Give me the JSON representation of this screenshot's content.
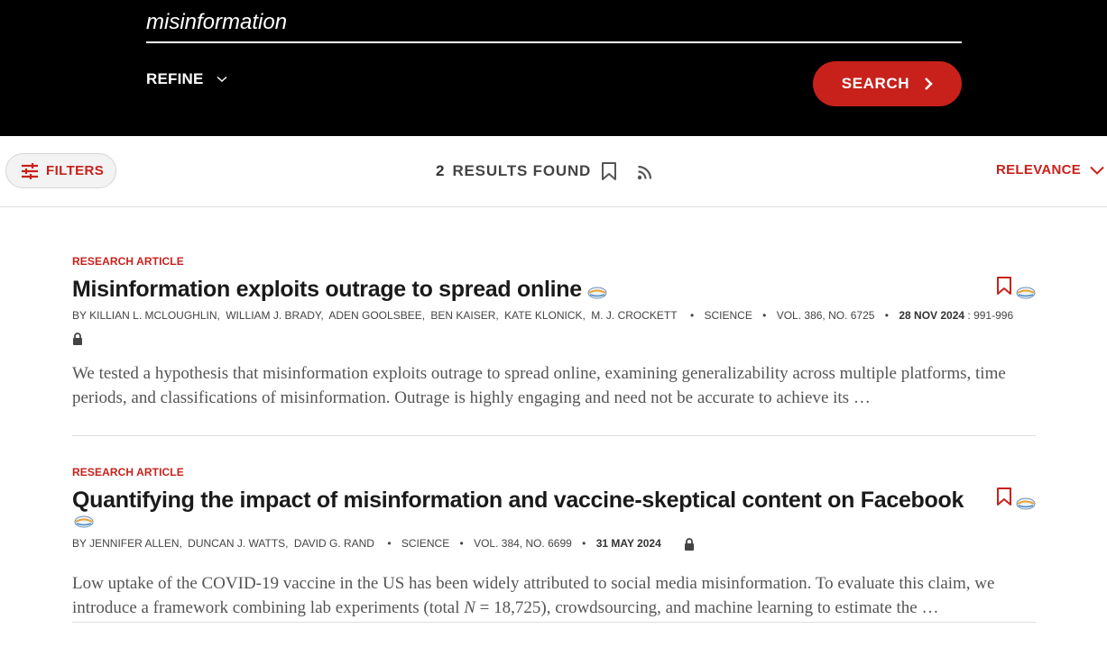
{
  "header": {
    "search_value": "misinformation",
    "refine_label": "REFINE",
    "search_button_label": "SEARCH"
  },
  "toolbar": {
    "filters_label": "FILTERS",
    "results_count": "2",
    "results_label": "RESULTS FOUND",
    "sort_label": "RELEVANCE"
  },
  "colors": {
    "accent": "#c8211b",
    "header_bg": "#000000"
  },
  "results": [
    {
      "type": "RESEARCH ARTICLE",
      "title": "Misinformation exploits outrage to spread online",
      "authors": [
        "BY KILLIAN L. MCLOUGHLIN,",
        "WILLIAM J. BRADY,",
        "ADEN GOOLSBEE,",
        "BEN KAISER,",
        "KATE KLONICK,",
        "M. J. CROCKETT"
      ],
      "journal": "SCIENCE",
      "volume": "VOL. 386, NO. 6725",
      "date": "28 NOV 2024",
      "pages": ": 991-996",
      "abstract": "We tested a hypothesis that misinformation exploits outrage to spread online, examining generalizability across multiple platforms, time periods, and classifications of misinformation. Outrage is highly engaging and need not be accurate to achieve its …"
    },
    {
      "type": "RESEARCH ARTICLE",
      "title": "Quantifying the impact of misinformation and vaccine-skeptical content on Facebook",
      "authors": [
        "BY JENNIFER ALLEN,",
        "DUNCAN J. WATTS,",
        "DAVID G. RAND"
      ],
      "journal": "SCIENCE",
      "volume": "VOL. 384, NO. 6699",
      "date": "31 MAY 2024",
      "abstract_part1": "Low uptake of the COVID-19 vaccine in the US has been widely attributed to social media misinformation. To evaluate this claim, we introduce a framework combining lab experiments (total ",
      "abstract_italic": "N",
      "abstract_part2": " = 18,725), crowdsourcing, and machine learning to estimate the …"
    }
  ]
}
